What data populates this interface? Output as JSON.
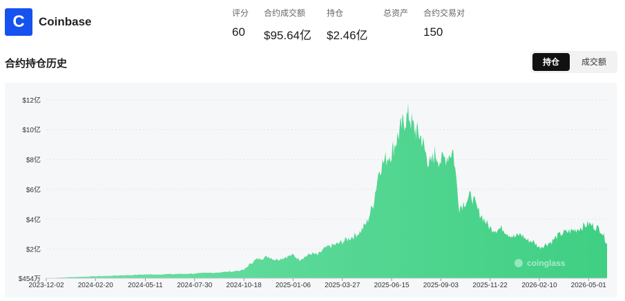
{
  "exchange": {
    "logo_letter": "C",
    "name": "Coinbase",
    "brand_color": "#1652f0"
  },
  "stats": [
    {
      "label": "评分",
      "value": "60"
    },
    {
      "label": "合约成交额",
      "value": "$95.64亿"
    },
    {
      "label": "持仓",
      "value": "$2.46亿"
    },
    {
      "label": "总资产",
      "value": ""
    },
    {
      "label": "合约交易对",
      "value": "150"
    }
  ],
  "section_title": "合约持仓历史",
  "toggle": {
    "active": "持仓",
    "inactive": "成交额"
  },
  "chart_data": {
    "type": "area",
    "color": "#3fcf83",
    "watermark": "coinglass",
    "y_unit": "亿 USD",
    "ylim": [
      0.04454,
      12.5
    ],
    "y_ticks": [
      {
        "value": 12,
        "label": "$12亿"
      },
      {
        "value": 10,
        "label": "$10亿"
      },
      {
        "value": 8,
        "label": "$8亿"
      },
      {
        "value": 6,
        "label": "$6亿"
      },
      {
        "value": 4,
        "label": "$4亿"
      },
      {
        "value": 2,
        "label": "$2亿"
      },
      {
        "value": 0.04454,
        "label": "$454万"
      }
    ],
    "x_ticks": [
      "2023-12-02",
      "2024-02-20",
      "2024-05-11",
      "2024-07-30",
      "2024-10-18",
      "2025-01-06",
      "2025-03-27",
      "2025-06-15",
      "2025-09-03",
      "2025-11-22",
      "2026-02-10",
      "2026-05-01"
    ],
    "x": [
      "2023-12-02",
      "2023-12-22",
      "2024-01-11",
      "2024-01-31",
      "2024-02-20",
      "2024-03-11",
      "2024-03-31",
      "2024-04-20",
      "2024-05-11",
      "2024-05-31",
      "2024-06-20",
      "2024-07-10",
      "2024-07-30",
      "2024-08-19",
      "2024-09-08",
      "2024-09-28",
      "2024-10-18",
      "2024-10-28",
      "2024-11-07",
      "2024-11-17",
      "2024-11-27",
      "2024-12-07",
      "2024-12-17",
      "2024-12-27",
      "2025-01-06",
      "2025-01-16",
      "2025-01-26",
      "2025-02-05",
      "2025-02-15",
      "2025-02-25",
      "2025-03-07",
      "2025-03-17",
      "2025-03-27",
      "2025-04-06",
      "2025-04-16",
      "2025-04-26",
      "2025-05-06",
      "2025-05-16",
      "2025-05-26",
      "2025-06-05",
      "2025-06-15",
      "2025-06-22",
      "2025-06-29",
      "2025-07-06",
      "2025-07-13",
      "2025-07-20",
      "2025-07-27",
      "2025-08-03",
      "2025-08-10",
      "2025-08-17",
      "2025-08-24",
      "2025-09-03",
      "2025-09-13",
      "2025-09-23",
      "2025-10-03",
      "2025-10-13",
      "2025-10-23",
      "2025-11-02",
      "2025-11-12",
      "2025-11-22",
      "2025-12-02",
      "2025-12-12",
      "2025-12-22",
      "2026-01-01",
      "2026-01-11",
      "2026-01-21",
      "2026-01-31",
      "2026-02-10",
      "2026-02-20",
      "2026-03-02",
      "2026-03-12",
      "2026-03-22",
      "2026-04-01",
      "2026-04-11",
      "2026-04-21",
      "2026-05-01",
      "2026-05-11",
      "2026-05-21",
      "2026-05-31"
    ],
    "values": [
      0.05,
      0.08,
      0.12,
      0.15,
      0.18,
      0.2,
      0.24,
      0.26,
      0.3,
      0.3,
      0.32,
      0.34,
      0.36,
      0.4,
      0.44,
      0.5,
      0.6,
      1.0,
      1.3,
      1.4,
      1.5,
      1.3,
      1.35,
      1.5,
      1.6,
      1.3,
      1.5,
      1.7,
      1.6,
      2.0,
      2.2,
      2.3,
      2.5,
      2.7,
      2.9,
      3.2,
      3.8,
      5.0,
      7.4,
      8.0,
      8.5,
      9.2,
      10.0,
      10.6,
      11.0,
      10.2,
      9.8,
      9.4,
      8.3,
      7.6,
      8.4,
      7.9,
      8.2,
      8.6,
      4.8,
      5.2,
      5.6,
      4.6,
      4.0,
      3.4,
      3.3,
      3.4,
      3.0,
      2.8,
      3.0,
      2.6,
      2.5,
      2.1,
      2.3,
      2.5,
      2.9,
      3.1,
      3.2,
      3.3,
      3.5,
      3.7,
      3.5,
      3.3,
      2.4
    ]
  }
}
